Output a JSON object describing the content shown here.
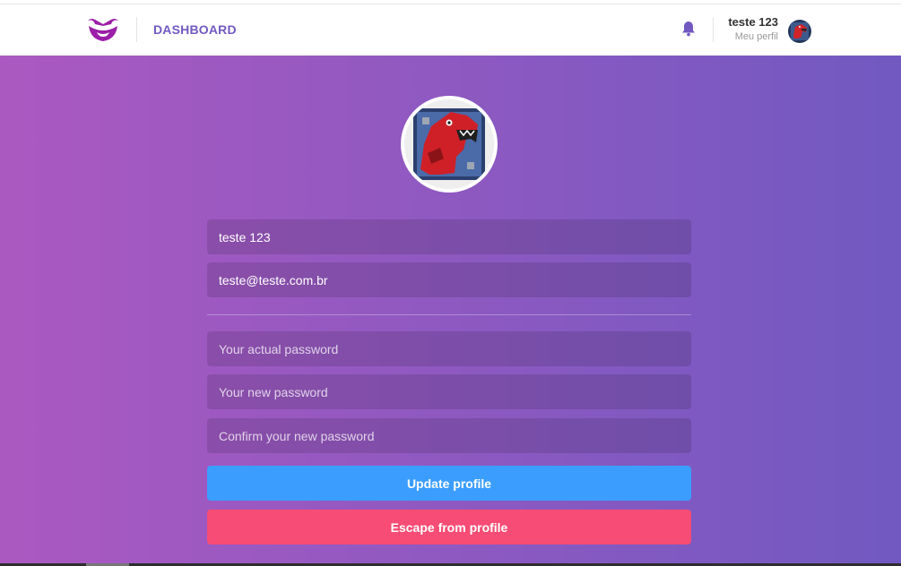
{
  "header": {
    "nav_label": "DASHBOARD",
    "profile": {
      "name": "teste 123",
      "link_label": "Meu perfil"
    }
  },
  "profile_form": {
    "name_value": "teste 123",
    "email_value": "teste@teste.com.br",
    "old_password_placeholder": "Your actual password",
    "new_password_placeholder": "Your new password",
    "confirm_password_placeholder": "Confirm your new password",
    "update_button": "Update profile",
    "escape_button": "Escape from profile"
  },
  "icons": {
    "logo": "mustache-smile-logo-icon",
    "bell": "bell-icon"
  },
  "colors": {
    "brand": "#7159c1",
    "gradient_start": "#ab59c1",
    "gradient_end": "#7159c1",
    "update_button": "#3b9eff",
    "escape_button": "#f64c75"
  }
}
